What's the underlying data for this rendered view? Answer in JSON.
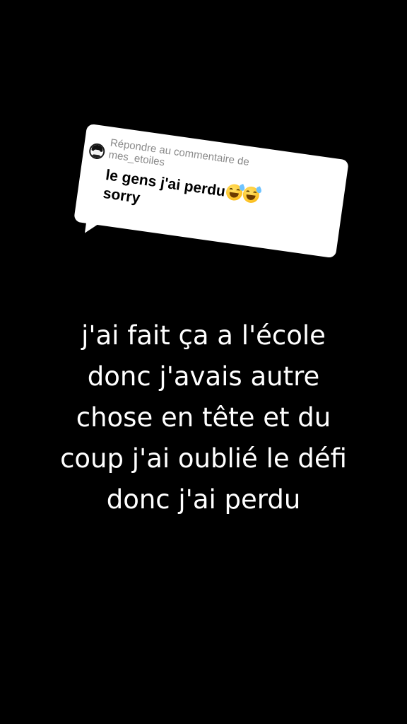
{
  "reply": {
    "header_line1": "Répondre au commentaire de",
    "header_line2": "mes_etoiles",
    "comment_line1": "le gens j'ai perdu",
    "comment_line2": "sorry",
    "emoji_icon": "sweat-smile-emoji"
  },
  "caption": {
    "lines": [
      "j'ai fait ça a l'école",
      "donc j'avais autre",
      "chose en tête et du",
      "coup j'ai oublié le défi",
      "donc j'ai perdu"
    ]
  },
  "colors": {
    "background": "#000000",
    "card": "#ffffff",
    "caption_text": "#ffffff",
    "header_text": "#8a8a8a"
  }
}
